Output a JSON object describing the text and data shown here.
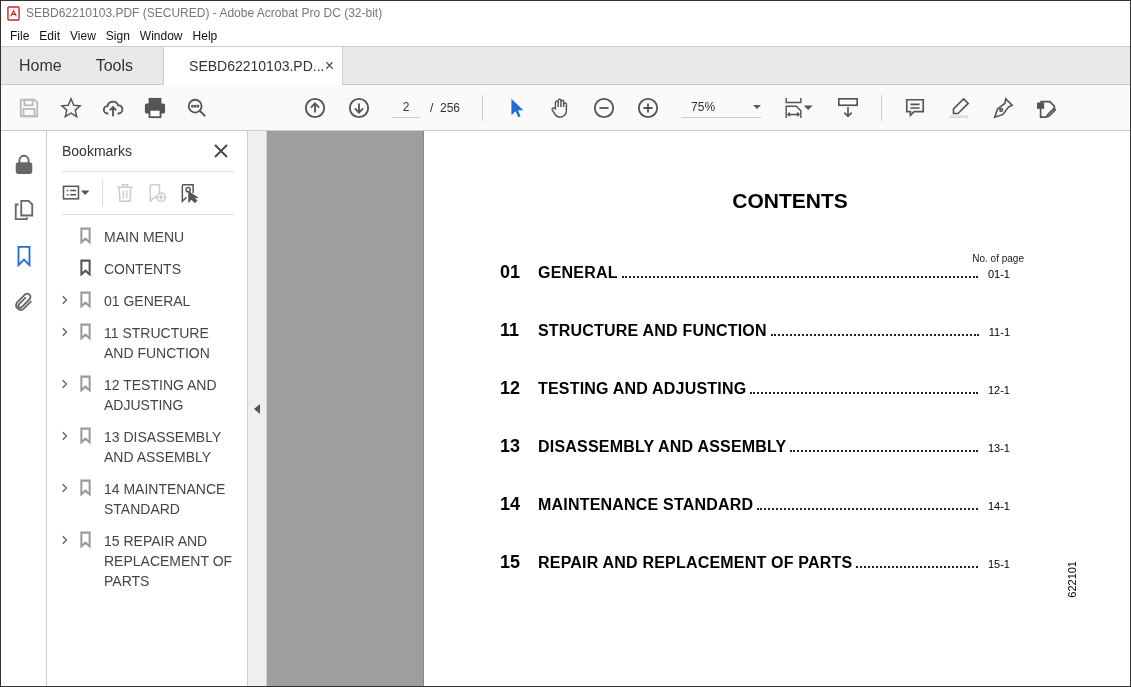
{
  "window": {
    "title": "SEBD62210103.PDF (SECURED) - Adobe Acrobat Pro DC (32-bit)"
  },
  "menu": [
    "File",
    "Edit",
    "View",
    "Sign",
    "Window",
    "Help"
  ],
  "tabs": [
    {
      "label": "Home",
      "selected": false,
      "kind": "nav"
    },
    {
      "label": "Tools",
      "selected": false,
      "kind": "nav"
    },
    {
      "label": "SEBD62210103.PD...",
      "selected": true,
      "kind": "document",
      "close": "×"
    }
  ],
  "toolbar": {
    "left": [
      {
        "kind": "save",
        "disabled": true
      },
      {
        "kind": "star",
        "disabled": false
      },
      {
        "kind": "upload",
        "disabled": false
      },
      {
        "kind": "print",
        "disabled": false
      },
      {
        "kind": "zoom-search",
        "disabled": false
      }
    ],
    "page": {
      "value": "2",
      "total": "/  256"
    },
    "zoom": {
      "value": "75%"
    },
    "right": [
      {
        "kind": "select",
        "selected": true
      },
      {
        "kind": "hand",
        "selected": false
      }
    ]
  },
  "rail": [
    {
      "kind": "lock",
      "selected": false
    },
    {
      "kind": "pages",
      "selected": false
    },
    {
      "kind": "bookmark",
      "selected": true
    },
    {
      "kind": "attach",
      "selected": false
    }
  ],
  "bookmarks": {
    "title": "Bookmarks",
    "tools": [
      {
        "kind": "options",
        "disabled": false
      },
      {
        "kind": "delete",
        "disabled": true
      },
      {
        "kind": "add",
        "disabled": true
      },
      {
        "kind": "find",
        "disabled": false
      }
    ],
    "items": [
      {
        "label": "MAIN MENU",
        "kind": "leaf",
        "selected": false
      },
      {
        "label": "CONTENTS",
        "kind": "leaf",
        "selected": true
      },
      {
        "label": "01 GENERAL",
        "kind": "branch",
        "selected": false
      },
      {
        "label": "11 STRUCTURE AND FUNCTION",
        "kind": "branch",
        "selected": false
      },
      {
        "label": "12 TESTING AND ADJUSTING",
        "kind": "branch",
        "selected": false
      },
      {
        "label": "13 DISASSEMBLY AND ASSEMBLY",
        "kind": "branch",
        "selected": false
      },
      {
        "label": "14 MAINTENANCE STANDARD",
        "kind": "branch",
        "selected": false
      },
      {
        "label": "15 REPAIR AND REPLACEMENT OF PARTS",
        "kind": "branch",
        "selected": false
      }
    ]
  },
  "document": {
    "title": "CONTENTS",
    "column_header": "No. of page",
    "side_code": "622101",
    "entries": [
      {
        "number": "01",
        "title": "GENERAL",
        "page": "01-1"
      },
      {
        "number": "11",
        "title": "STRUCTURE AND FUNCTION",
        "page": "11-1"
      },
      {
        "number": "12",
        "title": "TESTING AND ADJUSTING",
        "page": "12-1"
      },
      {
        "number": "13",
        "title": "DISASSEMBLY AND ASSEMBLY",
        "page": "13-1"
      },
      {
        "number": "14",
        "title": "MAINTENANCE STANDARD",
        "page": "14-1"
      },
      {
        "number": "15",
        "title": "REPAIR AND REPLACEMENT OF PARTS",
        "page": "15-1"
      }
    ]
  }
}
